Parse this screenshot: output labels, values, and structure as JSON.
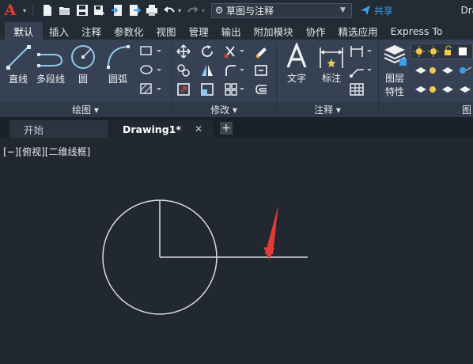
{
  "qat": {
    "workspace": "草图与注释",
    "share": "共享",
    "title_partial": "Dra"
  },
  "tabs": [
    "默认",
    "插入",
    "注释",
    "参数化",
    "视图",
    "管理",
    "输出",
    "附加模块",
    "协作",
    "精选应用",
    "Express To"
  ],
  "ribbon": {
    "draw": {
      "line": "直线",
      "polyline": "多段线",
      "circle": "圆",
      "arc": "圆弧",
      "panel": "绘图 ▾"
    },
    "modify": {
      "panel": "修改 ▾"
    },
    "annotation": {
      "text": "文字",
      "dimension": "标注",
      "panel": "注释 ▾"
    },
    "layers": {
      "props_line1": "图层",
      "props_line2": "特性",
      "panel_partial": "图"
    }
  },
  "doc_tabs": {
    "start": "开始",
    "drawing": "Drawing1*",
    "close": "✕",
    "new": "+"
  },
  "viewport": {
    "controls": "[−][俯视][二维线框]"
  },
  "colors": {
    "accent_red": "#e23c35",
    "share_blue": "#3aa0e8",
    "canvas_bg": "#212830",
    "ribbon_bg": "#364253",
    "geometry": "#d9dde1"
  }
}
